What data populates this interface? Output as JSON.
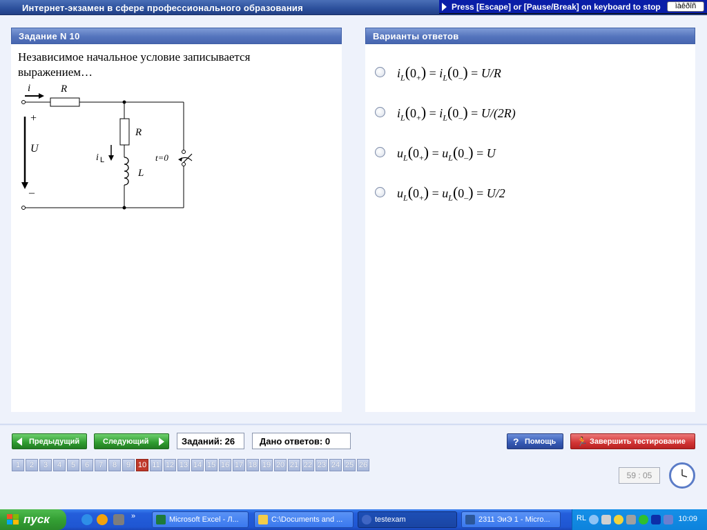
{
  "app": {
    "title": "Интернет-экзамен в сфере профессионального образования",
    "escape_hint": "Press [Escape] or [Pause/Break] on keyboard to stop",
    "lang_indicator": "ìàêðîñ"
  },
  "task_panel": {
    "header": "Задание N 10",
    "question": "Независимое начальное условие записывается выражением…",
    "circuit_labels": {
      "i": "i",
      "r1": "R",
      "r2": "R",
      "plus": "+",
      "u": "U",
      "minus": "–",
      "il_main": "i",
      "il_sub": "L",
      "l": "L",
      "switch": "t=0"
    }
  },
  "answers_panel": {
    "header": "Варианты ответов",
    "options": [
      {
        "lhs1": "i",
        "sub1": "L",
        "arg1": "0",
        "sign1": "+",
        "lhs2": "i",
        "sub2": "L",
        "arg2": "0",
        "sign2": "–",
        "rhs": "U/R"
      },
      {
        "lhs1": "i",
        "sub1": "L",
        "arg1": "0",
        "sign1": "+",
        "lhs2": "i",
        "sub2": "L",
        "arg2": "0",
        "sign2": "–",
        "rhs": "U/(2R)"
      },
      {
        "lhs1": "u",
        "sub1": "L",
        "arg1": "0",
        "sign1": "+",
        "lhs2": "u",
        "sub2": "L",
        "arg2": "0",
        "sign2": "–",
        "rhs": "U"
      },
      {
        "lhs1": "u",
        "sub1": "L",
        "arg1": "0",
        "sign1": "+",
        "lhs2": "u",
        "sub2": "L",
        "arg2": "0",
        "sign2": "–",
        "rhs": "U/2"
      }
    ]
  },
  "nav": {
    "prev_label": "Предыдущий",
    "next_label": "Следующий",
    "tasks_total": "Заданий: 26",
    "answers_given": "Дано ответов: 0",
    "help_label": "Помощь",
    "finish_label": "Завершить тестирование",
    "pages": [
      "1",
      "2",
      "3",
      "4",
      "5",
      "6",
      "7",
      "8",
      "9",
      "10",
      "11",
      "12",
      "13",
      "14",
      "15",
      "16",
      "17",
      "18",
      "19",
      "20",
      "21",
      "22",
      "23",
      "24",
      "25",
      "26"
    ],
    "current_page": "10",
    "timer": "59 : 05"
  },
  "taskbar": {
    "start_label": "пуск",
    "quicklaunch_more": "»",
    "tasks": [
      {
        "label": "Microsoft Excel - Л..."
      },
      {
        "label": "C:\\Documents and ..."
      },
      {
        "label": "testexam"
      },
      {
        "label": "2311 ЭиЭ 1 - Micro..."
      }
    ],
    "lang": "RL",
    "clock": "10:09"
  },
  "colors": {
    "header_blue": "#5474bd",
    "active_page_red": "#c0392b",
    "nav_green": "#2f9c2f",
    "finish_red": "#d23434"
  }
}
